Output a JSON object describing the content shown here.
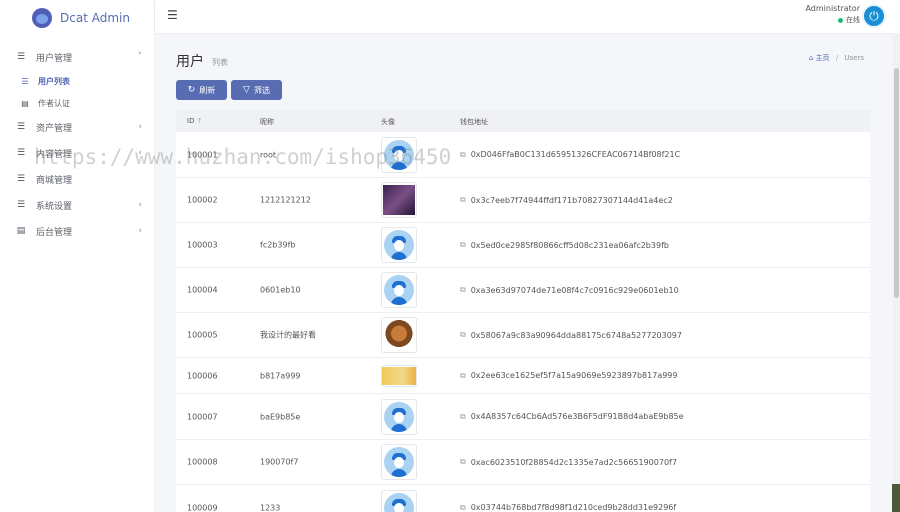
{
  "app": {
    "name": "Dcat Admin"
  },
  "sidebar": {
    "items": [
      {
        "label": "用户管理",
        "icon": "bars-icon",
        "arrow": "˅"
      },
      {
        "label": "资产管理",
        "icon": "bars-icon",
        "arrow": "‹"
      },
      {
        "label": "内容管理",
        "icon": "bars-icon",
        "arrow": "‹"
      },
      {
        "label": "商城管理",
        "icon": "bars-icon",
        "arrow": ""
      },
      {
        "label": "系统设置",
        "icon": "bars-icon",
        "arrow": "‹"
      },
      {
        "label": "后台管理",
        "icon": "server-icon",
        "arrow": "‹"
      }
    ],
    "sub_items": [
      {
        "label": "用户列表",
        "icon": "list-icon"
      },
      {
        "label": "作者认证",
        "icon": "file-icon"
      }
    ]
  },
  "header": {
    "user_name": "Administrator",
    "user_status": "在线"
  },
  "page": {
    "title": "用户",
    "subtitle": "列表",
    "breadcrumb": [
      "主页",
      "Users"
    ]
  },
  "toolbar": {
    "refresh_label": "刷新",
    "filter_label": "筛选"
  },
  "table": {
    "columns": [
      "ID",
      "昵称",
      "头像",
      "钱包地址"
    ],
    "rows": [
      {
        "id": "100001",
        "nickname": "root",
        "avatar": "default",
        "wallet": "0xD046FfaB0C131d65951326CFEAC06714Bf08f21C"
      },
      {
        "id": "100002",
        "nickname": "1212121212",
        "avatar": "dark",
        "wallet": "0x3c7eeb7f74944ffdf171b70827307144d41a4ec2"
      },
      {
        "id": "100003",
        "nickname": "fc2b39fb",
        "avatar": "default",
        "wallet": "0x5ed0ce2985f80866cff5d08c231ea06afc2b39fb"
      },
      {
        "id": "100004",
        "nickname": "0601eb10",
        "avatar": "default",
        "wallet": "0xa3e63d97074de71e08f4c7c0916c929e0601eb10"
      },
      {
        "id": "100005",
        "nickname": "我设计的最好看",
        "avatar": "monkey",
        "wallet": "0x58067a9c83a90964dda88175c6748a5277203097"
      },
      {
        "id": "100006",
        "nickname": "b817a999",
        "avatar": "yellow",
        "wallet": "0x2ee63ce1625ef5f7a15a9069e5923897b817a999"
      },
      {
        "id": "100007",
        "nickname": "baE9b85e",
        "avatar": "default",
        "wallet": "0x4A8357c64Cb6Ad576e3B6F5dF91B8d4abaE9b85e"
      },
      {
        "id": "100008",
        "nickname": "190070f7",
        "avatar": "default",
        "wallet": "0xac6023510f28854d2c1335e7ad2c5665190070f7"
      },
      {
        "id": "100009",
        "nickname": "1233",
        "avatar": "default",
        "wallet": "0x03744b768bd7f8d98f1d210ced9b28dd31e9296f"
      }
    ]
  },
  "watermark": "https://www.huzhan.com/ishop36450",
  "colors": {
    "primary": "#586cb1",
    "online": "#21b978",
    "avatar_ring": "#1a8fd6"
  }
}
